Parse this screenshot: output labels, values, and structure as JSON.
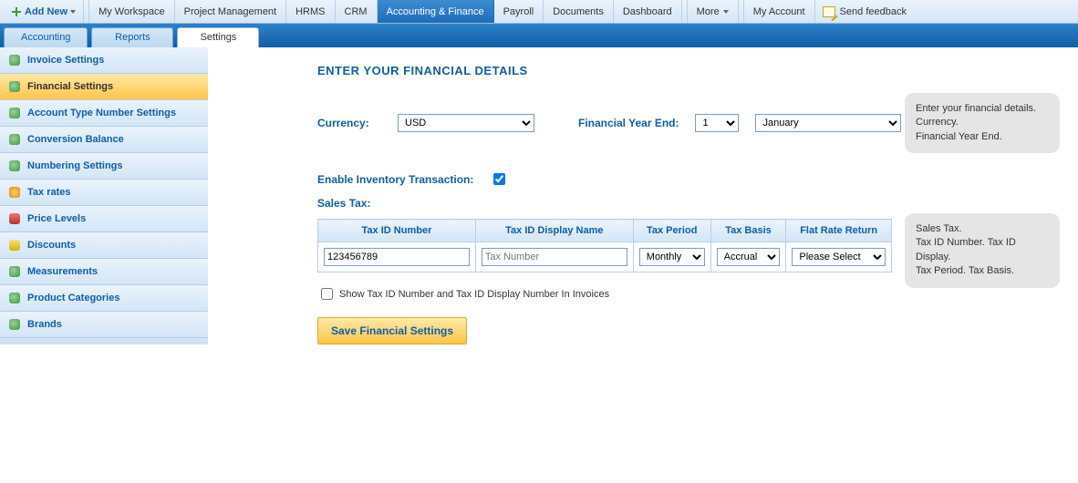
{
  "menubar": {
    "addnew": "Add New",
    "items": [
      "My Workspace",
      "Project Management",
      "HRMS",
      "CRM",
      "Accounting & Finance",
      "Payroll",
      "Documents",
      "Dashboard"
    ],
    "more": "More",
    "myaccount": "My Account",
    "feedback": "Send feedback",
    "active_index": 4
  },
  "subtabs": {
    "items": [
      "Accounting",
      "Reports",
      "Settings"
    ],
    "active_index": 2
  },
  "sidebar": {
    "items": [
      "Invoice Settings",
      "Financial Settings",
      "Account Type Number Settings",
      "Conversion Balance",
      "Numbering Settings",
      "Tax rates",
      "Price Levels",
      "Discounts",
      "Measurements",
      "Product Categories",
      "Brands"
    ],
    "active_index": 1
  },
  "page": {
    "title": "ENTER YOUR FINANCIAL DETAILS",
    "currency_label": "Currency:",
    "currency_value": "USD",
    "fye_label": "Financial Year End:",
    "fye_day": "1",
    "fye_month": "January",
    "enable_inventory_label": "Enable Inventory Transaction:",
    "enable_inventory_checked": true,
    "sales_tax_label": "Sales Tax:",
    "tax_table": {
      "headers": [
        "Tax ID Number",
        "Tax ID Display Name",
        "Tax Period",
        "Tax Basis",
        "Flat Rate Return"
      ],
      "row": {
        "tax_id_number": "123456789",
        "tax_id_display_placeholder": "Tax Number",
        "tax_period": "Monthly",
        "tax_basis": "Accrual",
        "flat_rate": "Please Select"
      }
    },
    "show_tax_in_invoices_label": "Show Tax ID Number and Tax ID Display Number In Invoices",
    "show_tax_in_invoices_checked": false,
    "save_button": "Save Financial Settings"
  },
  "tips": {
    "tip1": "Enter your financial details.\nCurrency.\nFinancial Year End.",
    "tip2": "Sales Tax.\nTax ID Number. Tax ID Display.\nTax Period. Tax Basis."
  }
}
